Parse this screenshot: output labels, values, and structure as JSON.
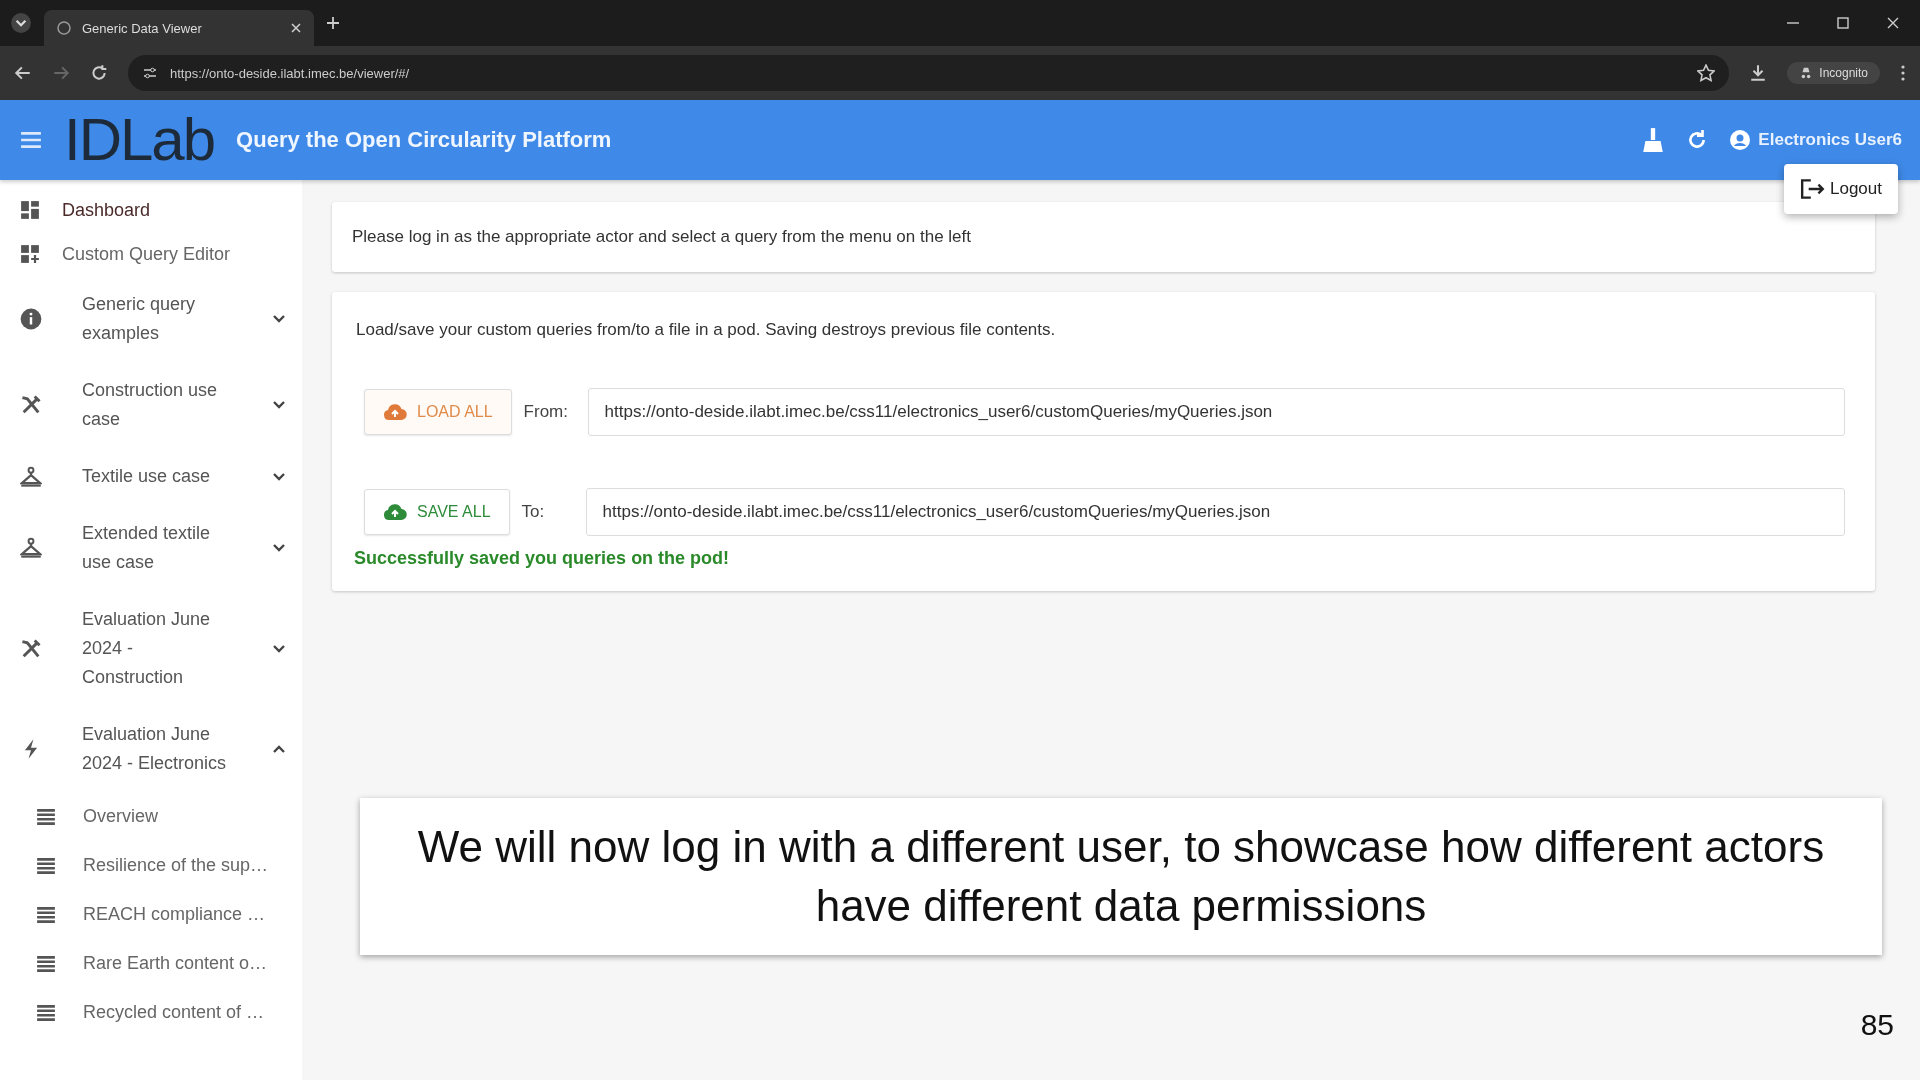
{
  "browser": {
    "tab_title": "Generic Data Viewer",
    "url": "https://onto-deside.ilabt.imec.be/viewer/#/",
    "profile": "Incognito"
  },
  "header": {
    "logo": "IDLab",
    "title": "Query the Open Circularity Platform",
    "user": "Electronics User6",
    "menu_items": [
      "Logout"
    ]
  },
  "sidebar": {
    "items": [
      {
        "kind": "link",
        "label": "Dashboard",
        "selected": true
      },
      {
        "kind": "link",
        "label": "Custom Query Editor",
        "selected": false
      },
      {
        "kind": "group",
        "label": "Generic query examples",
        "expanded": false
      },
      {
        "kind": "group",
        "label": "Construction use case",
        "expanded": false
      },
      {
        "kind": "group",
        "label": "Textile use case",
        "expanded": false
      },
      {
        "kind": "group",
        "label": "Extended textile use case",
        "expanded": false
      },
      {
        "kind": "group",
        "label": "Evaluation June 2024 - Construction",
        "expanded": false
      },
      {
        "kind": "group",
        "label": "Evaluation June 2024 - Electronics",
        "expanded": true,
        "children": [
          {
            "label": "Overview"
          },
          {
            "label": "Resilience of the sup…"
          },
          {
            "label": "REACH compliance …"
          },
          {
            "label": "Rare Earth content o…"
          },
          {
            "label": "Recycled content of …"
          }
        ]
      }
    ]
  },
  "notice": "Please log in as the appropriate actor and select a query from the menu on the left",
  "pod_card": {
    "description": "Load/save your custom queries from/to a file in a pod. Saving destroys previous file contents.",
    "rows": [
      {
        "kind": "load",
        "button": "LOAD ALL",
        "label": "From:",
        "value": "https://onto-deside.ilabt.imec.be/css11/electronics_user6/customQueries/myQueries.json"
      },
      {
        "kind": "save",
        "button": "SAVE ALL",
        "label": "To:",
        "value": "https://onto-deside.ilabt.imec.be/css11/electronics_user6/customQueries/myQueries.json"
      }
    ],
    "message": "Successfully saved you queries on the pod!"
  },
  "caption": "We will now log in with a different user, to showcase how different actors have different data permissions",
  "page_number": "85"
}
